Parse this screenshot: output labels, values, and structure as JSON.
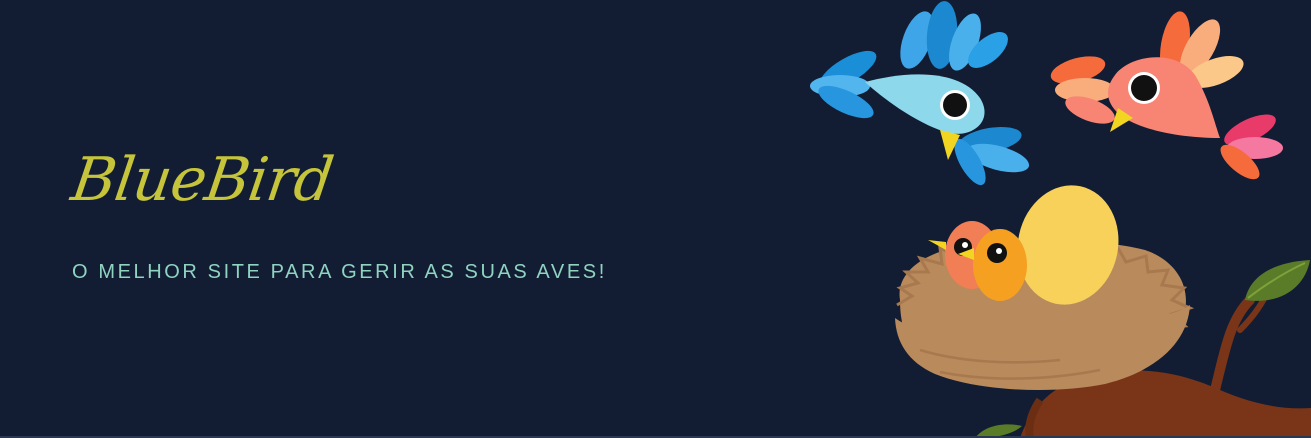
{
  "hero": {
    "brand": "BlueBird",
    "tagline": "O MELHOR SITE PARA GERIR AS SUAS AVES!"
  },
  "illustration": {
    "icons": [
      "blue-bird-icon",
      "pink-bird-icon",
      "nest-icon",
      "chicks-icon",
      "egg-icon",
      "branch-icon",
      "leaf-icon"
    ]
  },
  "colors": {
    "background": "#121d34",
    "brand": "#c5c43a",
    "tagline": "#8fd3c0",
    "blue_bird": "#8ed8ec",
    "pink_bird": "#f88474",
    "nest": "#b98a5c",
    "egg": "#f7d15a",
    "branch": "#7a3518",
    "leaf": "#5a7b28"
  }
}
